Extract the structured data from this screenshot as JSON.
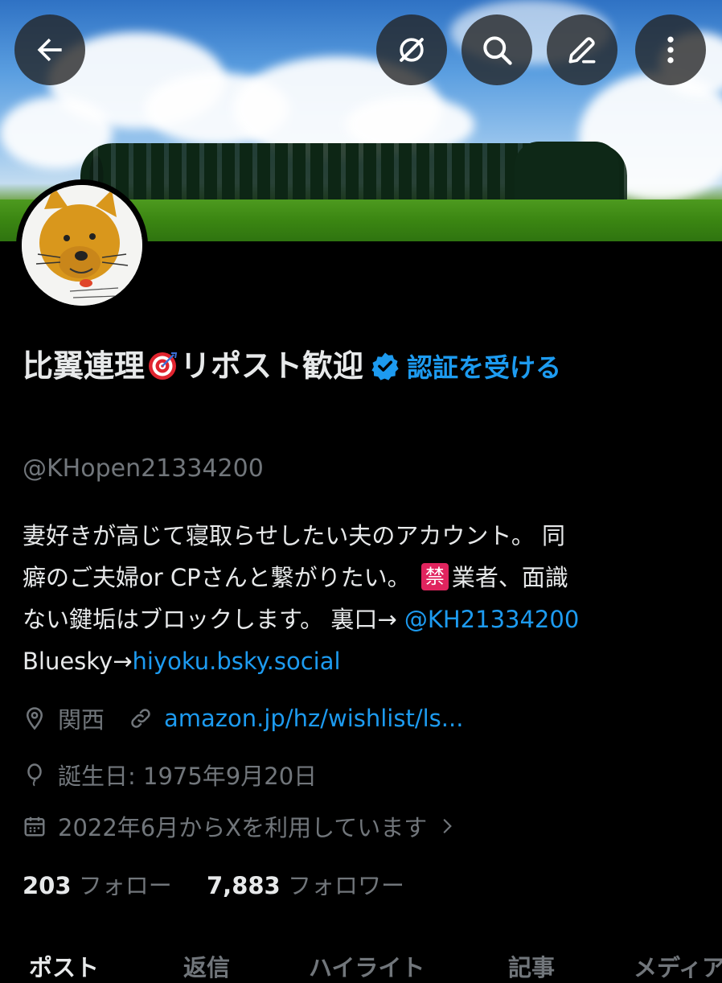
{
  "header": {
    "back_icon": "arrow-left-icon",
    "actions": [
      "grok-icon",
      "search-icon",
      "edit-icon",
      "more-vertical-icon"
    ]
  },
  "profile": {
    "name_prefix": "比翼連理",
    "name_suffix": "リポスト歓迎",
    "verify_link": "認証を受ける",
    "handle": "@KHopen21334200",
    "bio": {
      "line1": "妻好きが高じて寝取らせしたい夫のアカウント。 同",
      "line2_a": "癖のご夫婦or CPさんと繋がりたい。 ",
      "kin_badge": "禁",
      "line2_b": "業者、面識",
      "line3_a": "ない鍵垢はブロックします。 裏口→ ",
      "line3_link": "@KH21334200",
      "line4_a": "Bluesky→",
      "line4_link": "hiyoku.bsky.social"
    },
    "location": "関西",
    "website": "amazon.jp/hz/wishlist/ls...",
    "birthday": "誕生日: 1975年9月20日",
    "joined": "2022年6月からXを利用しています",
    "following_count": "203",
    "following_label": "フォロー",
    "followers_count": "7,883",
    "followers_label": "フォロワー"
  },
  "tabs": [
    "ポスト",
    "返信",
    "ハイライト",
    "記事",
    "メディア"
  ],
  "colors": {
    "accent": "#1d9bf0",
    "muted": "#71767b",
    "text": "#e7e9ea",
    "background": "#000000"
  }
}
